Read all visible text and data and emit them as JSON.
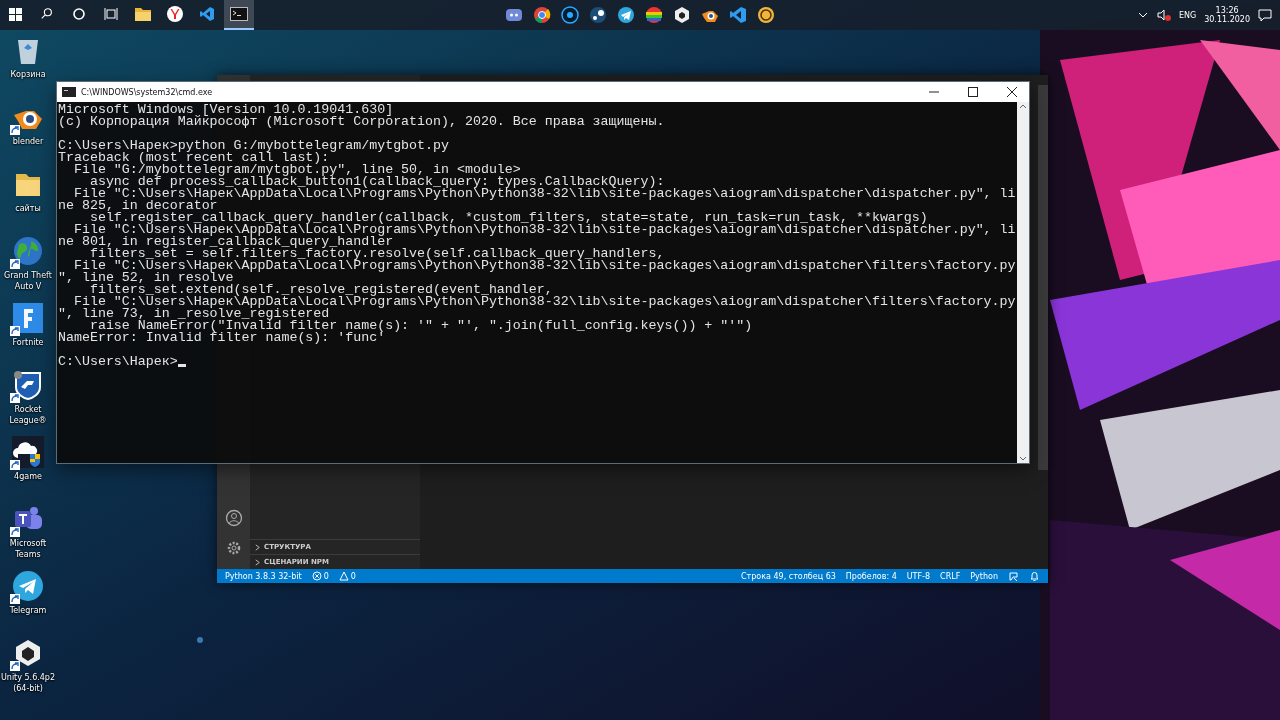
{
  "taskbar": {
    "apps": [
      {
        "selected": false
      },
      {
        "selected": false
      },
      {
        "selected": false
      },
      {
        "selected": true
      }
    ],
    "tray": {
      "language": "ENG",
      "time": "13:26",
      "date": "30.11.2020"
    }
  },
  "desktop_icons": [
    {
      "label": "Корзина",
      "shortcut": false
    },
    {
      "label": "blender",
      "shortcut": true
    },
    {
      "label": "сайты",
      "shortcut": false
    },
    {
      "label": "Grand Theft Auto V",
      "shortcut": true
    },
    {
      "label": "Fortnite",
      "shortcut": true
    },
    {
      "label": "Rocket League®",
      "shortcut": true
    },
    {
      "label": "4game",
      "shortcut": true
    },
    {
      "label": "Microsoft Teams",
      "shortcut": true
    },
    {
      "label": "Telegram",
      "shortcut": true
    },
    {
      "label": "Unity 5.6.4p2 (64-bit)",
      "shortcut": true
    }
  ],
  "editor_window": {
    "sidebar_sections": [
      {
        "label": "СТРУКТУРА",
        "expanded": false
      },
      {
        "label": "СЦЕНАРИИ NPM",
        "expanded": false
      }
    ],
    "status_bar": {
      "left": [
        {
          "kind": "text",
          "text": "Python 3.8.3 32-bit"
        },
        {
          "kind": "errors",
          "text": "0"
        },
        {
          "kind": "warnings",
          "text": "0"
        }
      ],
      "right": [
        {
          "kind": "text",
          "text": "Строка 49, столбец 63"
        },
        {
          "kind": "text",
          "text": "Пробелов: 4"
        },
        {
          "kind": "text",
          "text": "UTF-8"
        },
        {
          "kind": "text",
          "text": "CRLF"
        },
        {
          "kind": "text",
          "text": "Python"
        },
        {
          "kind": "feedback"
        },
        {
          "kind": "bell"
        }
      ]
    }
  },
  "console_window": {
    "title": "C:\\WINDOWS\\system32\\cmd.exe",
    "blocks": [
      [
        "Microsoft Windows [Version 10.0.19041.630]",
        "(c) Корпорация Майкрософт (Microsoft Corporation), 2020. Все права защищены."
      ],
      [
        "C:\\Users\\Нарек>python G:/mybottelegram/mytgbot.py",
        "Traceback (most recent call last):",
        "  File \"G:/mybottelegram/mytgbot.py\", line 50, in <module>",
        "    async def process_callback_button1(callback_query: types.CallbackQuery):",
        "  File \"C:\\Users\\Нарек\\AppData\\Local\\Programs\\Python\\Python38-32\\lib\\site-packages\\aiogram\\dispatcher\\dispatcher.py\", li",
        "ne 825, in decorator",
        "    self.register_callback_query_handler(callback, *custom_filters, state=state, run_task=run_task, **kwargs)",
        "  File \"C:\\Users\\Нарек\\AppData\\Local\\Programs\\Python\\Python38-32\\lib\\site-packages\\aiogram\\dispatcher\\dispatcher.py\", li",
        "ne 801, in register_callback_query_handler",
        "    filters_set = self.filters_factory.resolve(self.callback_query_handlers,",
        "  File \"C:\\Users\\Нарек\\AppData\\Local\\Programs\\Python\\Python38-32\\lib\\site-packages\\aiogram\\dispatcher\\filters\\factory.py",
        "\", line 52, in resolve",
        "    filters_set.extend(self._resolve_registered(event_handler,",
        "  File \"C:\\Users\\Нарек\\AppData\\Local\\Programs\\Python\\Python38-32\\lib\\site-packages\\aiogram\\dispatcher\\filters\\factory.py",
        "\", line 73, in _resolve_registered",
        "    raise NameError(\"Invalid filter name(s): '\" + \"', \".join(full_config.keys()) + \"'\")",
        "NameError: Invalid filter name(s): 'func'"
      ],
      [
        "C:\\Users\\Нарек>"
      ]
    ],
    "cursor": true
  }
}
